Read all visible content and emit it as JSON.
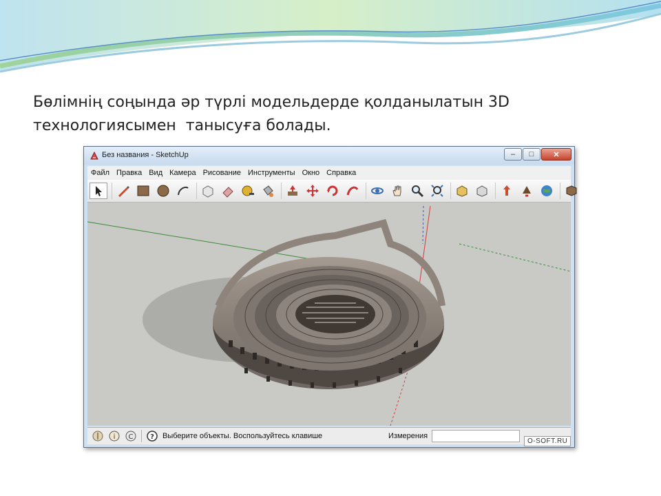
{
  "slide": {
    "text_lines": [
      "Бөлімнің соңында әр түрлі модельдерде қолданылатын 3D",
      "технологиясымен  танысуға болады."
    ]
  },
  "window": {
    "title": "Без названия - SketchUp",
    "controls": {
      "minimize": "–",
      "maximize": "□",
      "close": "✕"
    }
  },
  "menu": [
    "Файл",
    "Правка",
    "Вид",
    "Камера",
    "Рисование",
    "Инструменты",
    "Окно",
    "Справка"
  ],
  "toolbar": {
    "groups": [
      [
        "select-tool-icon"
      ],
      [
        "pencil-line-icon",
        "rectangle-icon",
        "circle-icon",
        "arc-icon"
      ],
      [
        "make-component-icon",
        "eraser-icon",
        "tape-measure-icon",
        "paint-bucket-icon"
      ],
      [
        "push-pull-icon",
        "move-icon",
        "rotate-icon",
        "follow-me-icon"
      ],
      [
        "orbit-icon",
        "pan-icon",
        "zoom-icon",
        "zoom-extents-icon"
      ],
      [
        "get-models-icon",
        "share-model-icon"
      ],
      [
        "component-warehouse-icon",
        "place-model-icon",
        "google-earth-icon"
      ],
      [
        "extension-icon"
      ]
    ]
  },
  "status": {
    "hint": "Выберите объекты. Воспользуйтесь клавише",
    "measure_label": "Измерения",
    "measure_value": ""
  },
  "watermark": "O-SOFT.RU",
  "colors": {
    "title_bar": "#c7daee",
    "viewport_bg": "#c9c9c6",
    "axis_red": "#d23c3c",
    "axis_green": "#3a8a3a",
    "axis_blue": "#3a55c8"
  }
}
